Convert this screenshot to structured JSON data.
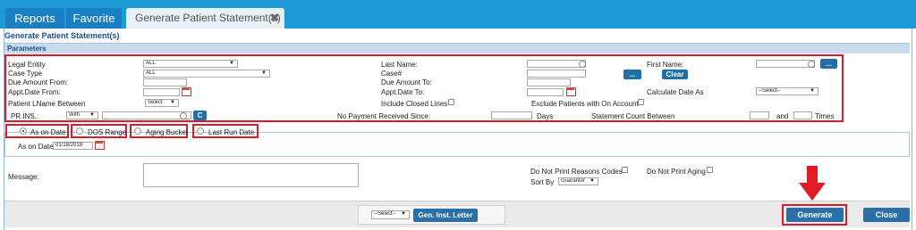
{
  "tabs": [
    {
      "label": "Reports"
    },
    {
      "label": "Favorite"
    },
    {
      "label": "Generate Patient Statement(s)",
      "close": "✖"
    }
  ],
  "page": {
    "title": "Generate Patient Statement(s)",
    "params_label": "Parameters"
  },
  "form": {
    "legal_entity": {
      "label": "Legal Entity",
      "value": "ALL"
    },
    "case_type": {
      "label": "Case Type",
      "value": "ALL"
    },
    "due_amount_from": {
      "label": "Due Amount From:"
    },
    "appt_date_from": {
      "label": "Appt.Date From:"
    },
    "patient_lname_between": {
      "label": "Patient LName Between",
      "value": "Select"
    },
    "pr_ins": {
      "label": "PR.INS.:",
      "value": "With",
      "c_button": "C"
    },
    "last_name": {
      "label": "Last Name:"
    },
    "case_no": {
      "label": "Case#",
      "btn_more": "...",
      "btn_clear": "Clear"
    },
    "due_amount_to": {
      "label": "Due Amount To:"
    },
    "appt_date_to": {
      "label": "Appt.Date To:"
    },
    "include_closed_lines": {
      "label": "Include Closed Lines"
    },
    "no_payment_since": {
      "label": "No Payment Received Since:",
      "unit": "Days"
    },
    "first_name": {
      "label": "First Name:",
      "btn_more": "..."
    },
    "calculate_date_as": {
      "label": "Calculate Date As",
      "value": "--Select--"
    },
    "exclude_on_account": {
      "label": "Exclude Patients with On Account"
    },
    "statement_count": {
      "label": "Statement Count Between",
      "and": "and",
      "unit": "Times"
    }
  },
  "date_options": {
    "as_on_date": "As on Date",
    "dos_range": "DOS Range",
    "aging_bucket": "Aging Bucket",
    "last_run_date": "Last Run Date",
    "as_on_date_label": "As on Date",
    "as_on_date_value": "01/18/2018"
  },
  "message": {
    "label": "Message:"
  },
  "options": {
    "no_reason_codes": "Do Not Print Reasons Codes",
    "no_aging": "Do Not Print Aging",
    "sort_by_label": "Sort By",
    "sort_by_value": "Guarantor"
  },
  "footer": {
    "select_value": "--Select--",
    "gen_inst_letter": "Gen. Inst. Letter",
    "generate": "Generate",
    "close": "Close"
  },
  "colors": {
    "topbar": "#1c9ad6",
    "highlight": "#d71d2a",
    "arrow": "#e01b24"
  }
}
